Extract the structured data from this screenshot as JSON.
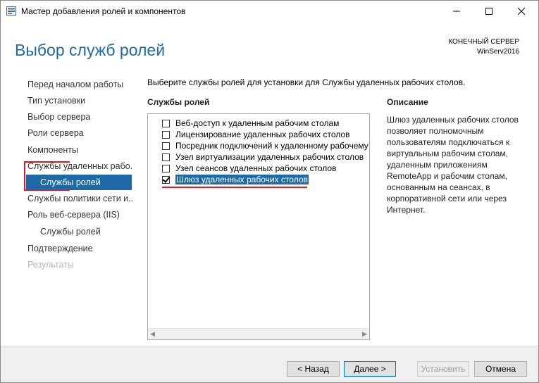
{
  "window": {
    "title": "Мастер добавления ролей и компонентов",
    "icons": [
      "server-manager-icon",
      "minimize-icon",
      "maximize-icon",
      "close-icon"
    ]
  },
  "header": {
    "page_title": "Выбор служб ролей",
    "destination_label": "КОНЕЧНЫЙ СЕРВЕР",
    "destination_value": "WinServ2016"
  },
  "nav": {
    "items": [
      {
        "label": "Перед началом работы"
      },
      {
        "label": "Тип установки"
      },
      {
        "label": "Выбор сервера"
      },
      {
        "label": "Роли сервера"
      },
      {
        "label": "Компоненты"
      },
      {
        "label": "Службы удаленных рабо..."
      },
      {
        "label": "Службы ролей"
      },
      {
        "label": "Службы политики сети и..."
      },
      {
        "label": "Роль веб-сервера (IIS)"
      },
      {
        "label": "Службы ролей"
      },
      {
        "label": "Подтверждение"
      },
      {
        "label": "Результаты"
      }
    ]
  },
  "main": {
    "instruction": "Выберите службы ролей для установки для Службы удаленных рабочих столов.",
    "roles_header": "Службы ролей",
    "description_header": "Описание",
    "role_services": [
      {
        "label": "Веб-доступ к удаленным рабочим столам",
        "checked": false
      },
      {
        "label": "Лицензирование удаленных рабочих столов",
        "checked": false
      },
      {
        "label": "Посредник подключений к удаленному рабочему с",
        "checked": false
      },
      {
        "label": "Узел виртуализации удаленных рабочих столов",
        "checked": false
      },
      {
        "label": "Узел сеансов удаленных рабочих столов",
        "checked": false
      },
      {
        "label": "Шлюз удаленных рабочих столов",
        "checked": true
      }
    ],
    "description": "Шлюз удаленных рабочих столов позволяет полномочным пользователям подключаться к виртуальным рабочим столам, удаленным приложениям RemoteApp и рабочим столам, основанным на сеансах, в корпоративной сети или через Интернет."
  },
  "footer": {
    "back_label": "< Назад",
    "next_label": "Далее >",
    "install_label": "Установить",
    "cancel_label": "Отмена"
  },
  "colors": {
    "accent": "#1e6aa8",
    "highlight_red": "#d81e2a"
  }
}
